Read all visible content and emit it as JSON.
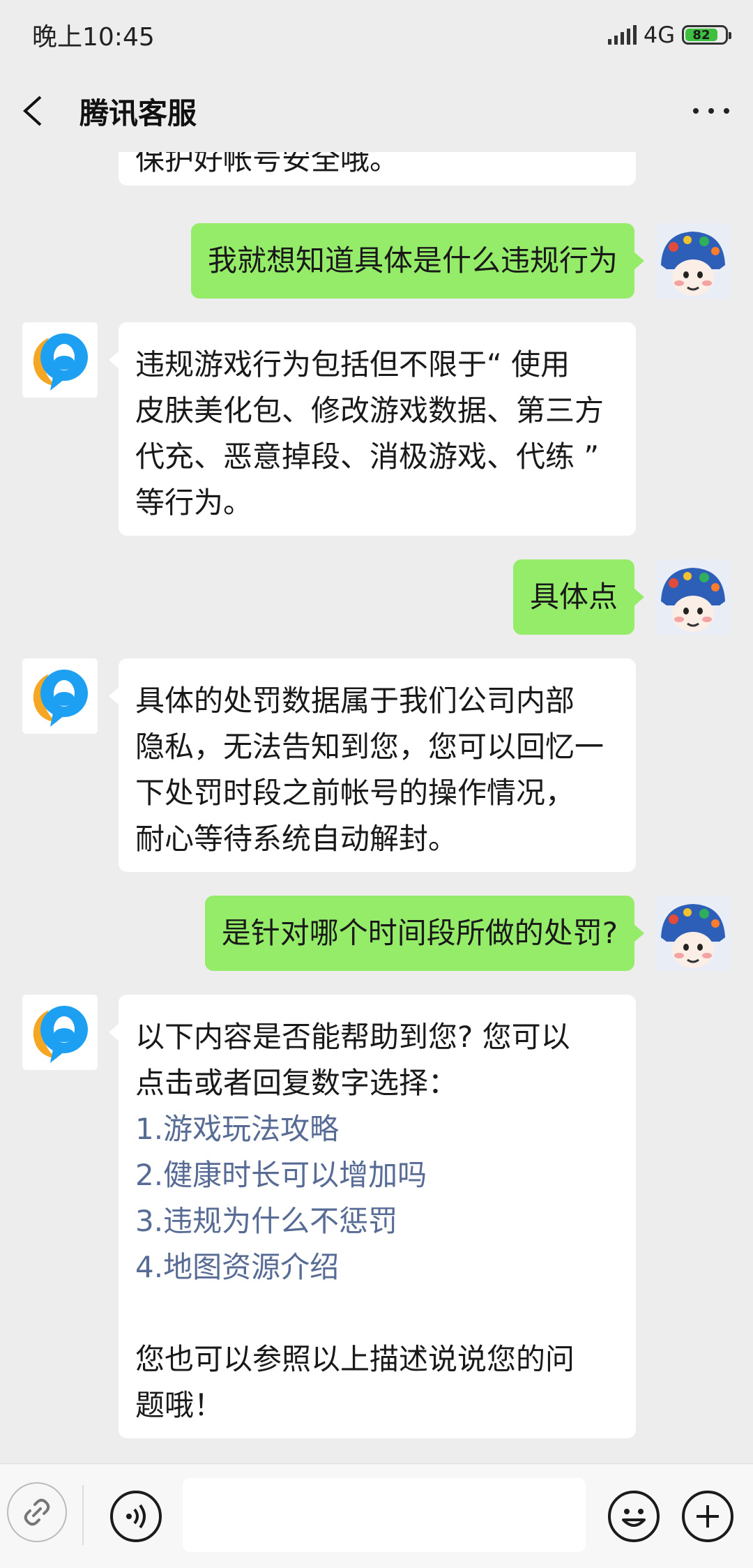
{
  "status_bar": {
    "time": "晚上10:45",
    "network": "4G",
    "battery": "82"
  },
  "header": {
    "title": "腾讯客服"
  },
  "messages": [
    {
      "sender": "bot",
      "text": "保护好帐号安全哦。"
    },
    {
      "sender": "user",
      "text": "我就想知道具体是什么违规行为"
    },
    {
      "sender": "bot",
      "lines": [
        "违规游戏行为包括但不限于“ 使用",
        "皮肤美化包、修改游戏数据、第三方",
        "代充、恶意掉段、消极游戏、代练 ”",
        "等行为。"
      ]
    },
    {
      "sender": "user",
      "text": "具体点"
    },
    {
      "sender": "bot",
      "lines": [
        "具体的处罚数据属于我们公司内部",
        "隐私，无法告知到您，您可以回忆一",
        "下处罚时段之前帐号的操作情况，",
        "耐心等待系统自动解封。"
      ]
    },
    {
      "sender": "user",
      "text": "是针对哪个时间段所做的处罚?"
    },
    {
      "sender": "bot",
      "intro_lines": [
        "以下内容是否能帮助到您? 您可以",
        "点击或者回复数字选择："
      ],
      "options": [
        "1.游戏玩法攻略",
        "2.健康时长可以增加吗",
        "3.违规为什么不惩罚",
        "4.地图资源介绍"
      ],
      "outro_lines": [
        "您也可以参照以上描述说说您的问",
        "题哦！"
      ]
    }
  ],
  "icons": {
    "back": "chevron-left-icon",
    "more": "more-dots-icon",
    "mini_program": "link-icon",
    "voice": "voice-icon",
    "emoji": "emoji-icon",
    "plus": "plus-icon"
  },
  "colors": {
    "background": "#ededed",
    "user_bubble": "#95ec69",
    "bot_bubble": "#ffffff",
    "link": "#576b95"
  }
}
